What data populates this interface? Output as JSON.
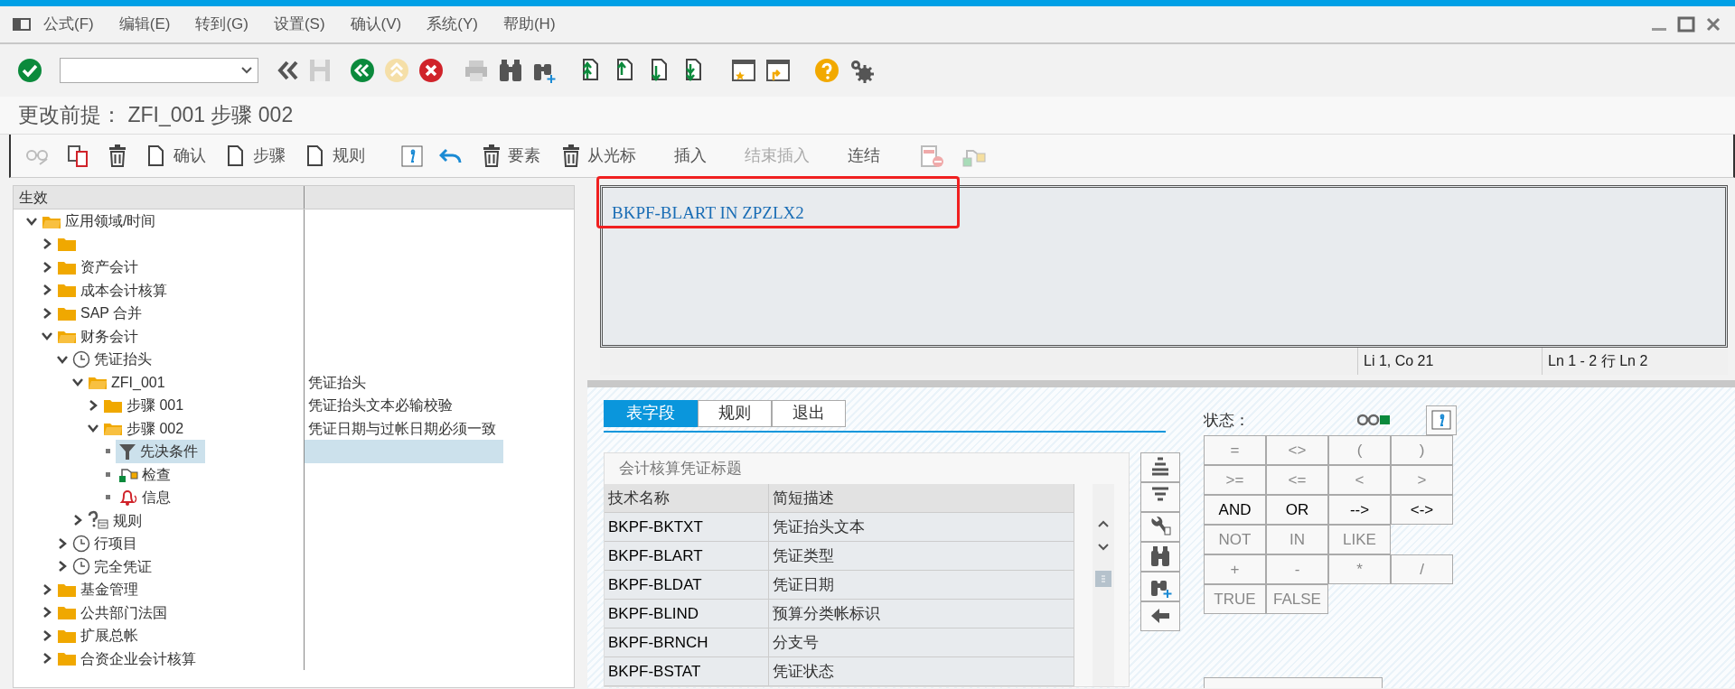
{
  "menu": {
    "items": [
      "公式(F)",
      "编辑(E)",
      "转到(G)",
      "设置(S)",
      "确认(V)",
      "系统(Y)",
      "帮助(H)"
    ]
  },
  "title": "更改前提：  ZFI_001 步骤 002",
  "app_toolbar": [
    {
      "label": "确认",
      "disabled": false
    },
    {
      "label": "步骤",
      "disabled": false
    },
    {
      "label": "规则",
      "disabled": false
    },
    {
      "label": "要素",
      "disabled": false
    },
    {
      "label": "从光标",
      "disabled": false
    },
    {
      "label": "插入",
      "disabled": false
    },
    {
      "label": "结束插入",
      "disabled": true
    },
    {
      "label": "连结",
      "disabled": false
    }
  ],
  "tree": {
    "columns": [
      "生效"
    ],
    "items": [
      {
        "label": "应用领域/时间",
        "kind": "folder",
        "expanded": true,
        "selected": false,
        "children": [
          {
            "kind": "folder",
            "expanded": false,
            "selected": false
          },
          {
            "label": "资产会计",
            "kind": "folder",
            "expanded": false,
            "selected": false
          },
          {
            "label": "成本会计核算",
            "kind": "folder",
            "expanded": false,
            "selected": false
          },
          {
            "label": "SAP 合并",
            "kind": "folder",
            "expanded": false,
            "selected": false
          },
          {
            "label": "财务会计",
            "kind": "folder",
            "expanded": true,
            "selected": false,
            "children": [
              {
                "label": "凭证抬头",
                "kind": "event",
                "expanded": true,
                "selected": false,
                "children": [
                  {
                    "label": "ZFI_001",
                    "description": "凭证抬头",
                    "kind": "folder",
                    "expanded": true,
                    "selected": false,
                    "children": [
                      {
                        "label": "步骤 001",
                        "description": "凭证抬头文本必输校验",
                        "kind": "folder",
                        "expanded": false,
                        "selected": false
                      },
                      {
                        "label": "步骤 002",
                        "description": "凭证日期与过帐日期必须一致",
                        "kind": "folder",
                        "expanded": true,
                        "selected": false,
                        "children": [
                          {
                            "label": "先决条件",
                            "kind": "precondition",
                            "selected": true
                          },
                          {
                            "label": "检查",
                            "kind": "check",
                            "selected": false
                          },
                          {
                            "label": "信息",
                            "kind": "message",
                            "selected": false
                          }
                        ]
                      }
                    ]
                  },
                  {
                    "label": "规则",
                    "kind": "rule",
                    "expanded": false,
                    "selected": false
                  }
                ]
              },
              {
                "label": "行项目",
                "kind": "event",
                "expanded": false,
                "selected": false
              },
              {
                "label": "完全凭证",
                "kind": "event",
                "expanded": false,
                "selected": false
              }
            ]
          },
          {
            "label": "基金管理",
            "kind": "folder",
            "expanded": false,
            "selected": false
          },
          {
            "label": "公共部门法国",
            "kind": "folder",
            "expanded": false,
            "selected": false
          },
          {
            "label": "扩展总帐",
            "kind": "folder",
            "expanded": false,
            "selected": false
          },
          {
            "label": "合资企业会计核算",
            "kind": "folder",
            "expanded": false,
            "selected": false
          }
        ]
      }
    ]
  },
  "editor": {
    "text": "BKPF-BLART IN ZPZLX2",
    "highlighted": true
  },
  "editor_status": [
    "Li 1, Co 21",
    "Ln 1 - 2 行 Ln 2"
  ],
  "tabs": [
    {
      "label": "表字段",
      "selected": true
    },
    {
      "label": "规则",
      "selected": false
    },
    {
      "label": "退出",
      "selected": false
    }
  ],
  "field_table": {
    "title": "会计核算凭证标题",
    "columns": [
      "技术名称",
      "简短描述"
    ],
    "rows": [
      [
        "BKPF-BKTXT",
        "凭证抬头文本"
      ],
      [
        "BKPF-BLART",
        "凭证类型"
      ],
      [
        "BKPF-BLDAT",
        "凭证日期"
      ],
      [
        "BKPF-BLIND",
        "预算分类帐标识"
      ],
      [
        "BKPF-BRNCH",
        "分支号"
      ],
      [
        "BKPF-BSTAT",
        "凭证状态"
      ]
    ]
  },
  "operators": {
    "status_label": "状态：",
    "rows": [
      [
        {
          "label": "=",
          "disabled": true
        },
        {
          "label": "<>",
          "disabled": true
        },
        {
          "label": "(",
          "disabled": true
        },
        {
          "label": ")",
          "disabled": true
        }
      ],
      [
        {
          "label": ">=",
          "disabled": true
        },
        {
          "label": "<=",
          "disabled": true
        },
        {
          "label": "<",
          "disabled": true
        },
        {
          "label": ">",
          "disabled": true
        }
      ],
      [
        {
          "label": "AND",
          "disabled": false
        },
        {
          "label": "OR",
          "disabled": false
        },
        {
          "label": "-->",
          "disabled": false
        },
        {
          "label": "<->",
          "disabled": false
        }
      ],
      [
        {
          "label": "NOT",
          "disabled": true
        },
        {
          "label": "IN",
          "disabled": true
        },
        {
          "label": "LIKE",
          "disabled": true
        }
      ],
      [
        {
          "label": "+",
          "disabled": true
        },
        {
          "label": "-",
          "disabled": true
        },
        {
          "label": "*",
          "disabled": true
        },
        {
          "label": "/",
          "disabled": true
        }
      ],
      [
        {
          "label": "TRUE",
          "disabled": true
        },
        {
          "label": "FALSE",
          "disabled": true
        }
      ]
    ]
  }
}
